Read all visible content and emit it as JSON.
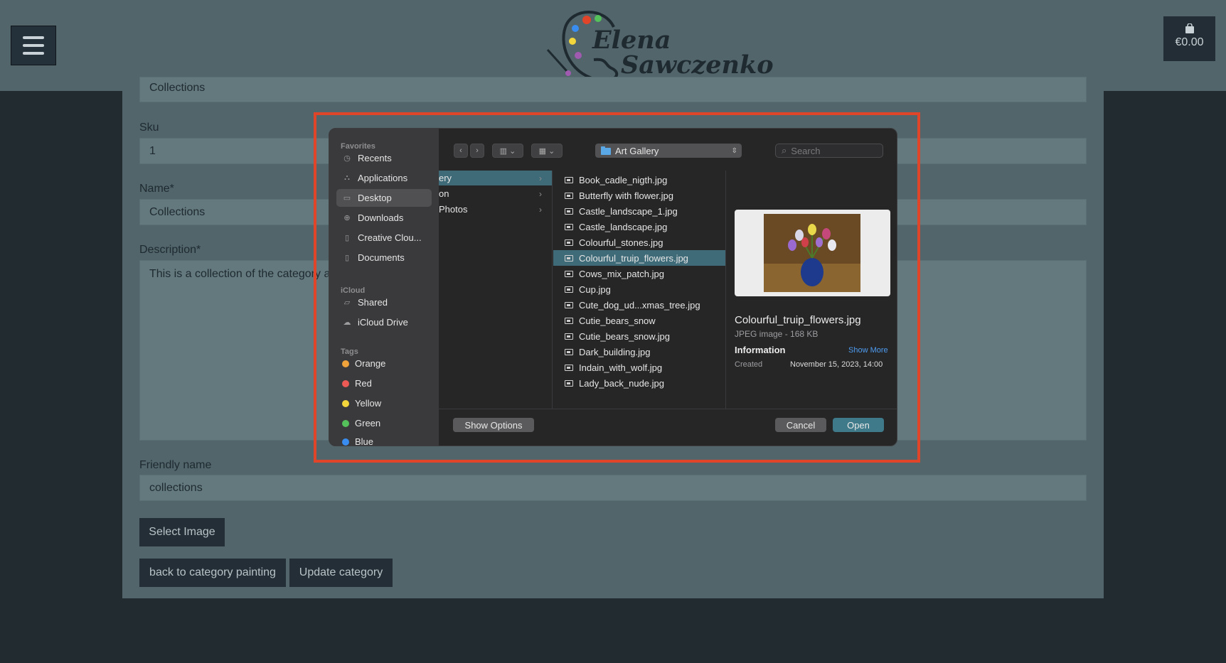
{
  "header": {
    "brand_line1": "Elena",
    "brand_line2": "Sawczenko",
    "cart_total": "€0.00",
    "icons": {
      "menu": "hamburger-icon",
      "cart": "shopping-bag-icon"
    }
  },
  "form": {
    "top_value": "Collections",
    "sku_label": "Sku",
    "sku_value": "1",
    "name_label": "Name*",
    "name_value": "Collections",
    "description_label": "Description*",
    "description_value": "This is a collection of the category a",
    "friendly_label": "Friendly name",
    "friendly_value": "collections",
    "select_image": "Select Image",
    "back_button": "back to category painting",
    "update_button": "Update category"
  },
  "dialog": {
    "sidebar": {
      "favorites_header": "Favorites",
      "favorites": [
        "Recents",
        "Applications",
        "Desktop",
        "Downloads",
        "Creative Clou...",
        "Documents"
      ],
      "selected_favorite": "Desktop",
      "icloud_header": "iCloud",
      "icloud": [
        "Shared",
        "iCloud Drive"
      ],
      "tags_header": "Tags",
      "tags": [
        {
          "label": "Orange",
          "color": "#f0a33a"
        },
        {
          "label": "Red",
          "color": "#ed5a55"
        },
        {
          "label": "Yellow",
          "color": "#f2d63b"
        },
        {
          "label": "Green",
          "color": "#54c15a"
        },
        {
          "label": "Blue",
          "color": "#3a8df0"
        }
      ]
    },
    "location": "Art Gallery",
    "search_placeholder": "Search",
    "column1": [
      "ery",
      "on",
      "Photos"
    ],
    "files": [
      "Book_cadle_nigth.jpg",
      "Butterfly with flower.jpg",
      "Castle_landscape_1.jpg",
      "Castle_landscape.jpg",
      "Colourful_stones.jpg",
      "Colourful_truip_flowers.jpg",
      "Cows_mix_patch.jpg",
      "Cup.jpg",
      "Cute_dog_ud...xmas_tree.jpg",
      "Cutie_bears_snow",
      "Cutie_bears_snow.jpg",
      "Dark_building.jpg",
      "Indain_with_wolf.jpg",
      "Lady_back_nude.jpg"
    ],
    "selected_file": "Colourful_truip_flowers.jpg",
    "preview": {
      "filename": "Colourful_truip_flowers.jpg",
      "kind": "JPEG image - 168 KB",
      "info_label": "Information",
      "show_more": "Show More",
      "created_label": "Created",
      "created_value": "November 15, 2023, 14:00"
    },
    "show_options": "Show Options",
    "cancel": "Cancel",
    "open": "Open",
    "accent": "#3f6b78",
    "highlight_color": "#e0452a"
  }
}
